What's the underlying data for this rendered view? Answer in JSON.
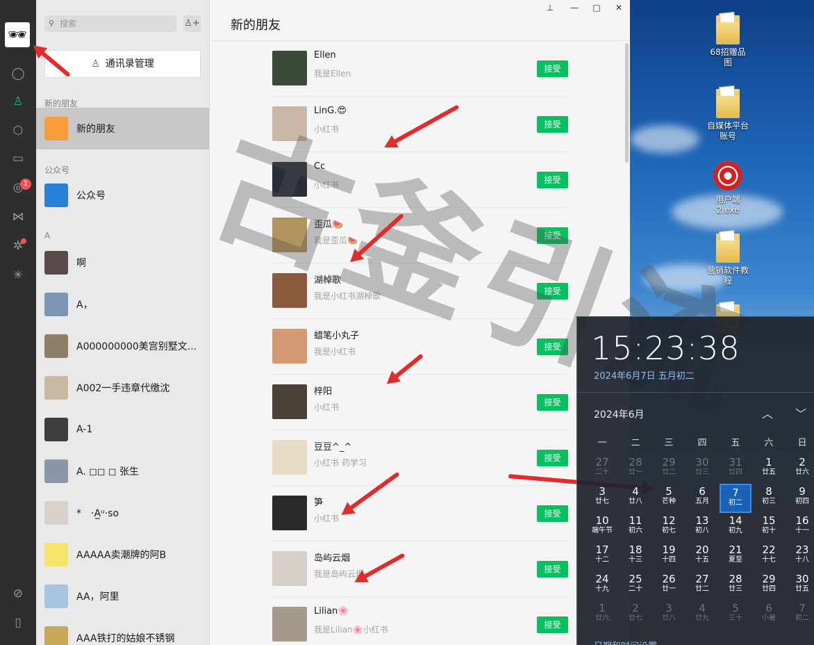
{
  "sidebar": {
    "avatar_glyph": "🕶",
    "badge_count": "1"
  },
  "list": {
    "search_placeholder": "搜索",
    "manage_label": "通讯录管理",
    "sections": {
      "new_friends": "新的朋友",
      "official": "公众号",
      "letter_a": "A"
    },
    "rows": [
      {
        "name": "新的朋友",
        "color": "#fa9d3b"
      },
      {
        "name": "公众号",
        "color": "#2782d7"
      },
      {
        "name": "啊",
        "color": "#5a4a4a"
      },
      {
        "name": "A，",
        "color": "#7e94b4"
      },
      {
        "name": "A000000000美宫别墅文...",
        "color": "#8f7f66"
      },
      {
        "name": "A002一手违章代缴沈",
        "color": "#c9b9a0"
      },
      {
        "name": "A-1",
        "color": "#3d3d3d"
      },
      {
        "name": "A. ◻◻ ◻ 张生",
        "color": "#8a95a5"
      },
      {
        "name": "*　·A̲ᵘ·so",
        "color": "#d9d2cc"
      },
      {
        "name": "AAAAA卖潮牌的阿B",
        "color": "#f5e36a"
      },
      {
        "name": "AA，阿里",
        "color": "#a6c4e0"
      },
      {
        "name": "AAA铁打的姑娘不锈钢",
        "color": "#c8a75a"
      }
    ]
  },
  "main": {
    "title": "新的朋友",
    "accept_label": "接受",
    "friends": [
      {
        "name": "Ellen",
        "msg": "我是Ellen",
        "color": "#3c4a3a"
      },
      {
        "name": "LinG.😍",
        "msg": "小红书",
        "color": "#c9b8a6"
      },
      {
        "name": "Cc",
        "msg": "小红书",
        "color": "#2a2e3a"
      },
      {
        "name": "歪瓜🍉",
        "msg": "我是歪瓜🍉",
        "color": "#b2935e"
      },
      {
        "name": "湖棹歌",
        "msg": "我是小红书湖棹歌",
        "color": "#8c5a3c"
      },
      {
        "name": "蜡笔小丸子",
        "msg": "我是小红书",
        "color": "#d49a73"
      },
      {
        "name": "梓阳",
        "msg": "小红书",
        "color": "#4a4238"
      },
      {
        "name": "豆豆^_^",
        "msg": "小红书 药学习",
        "color": "#e8dcc6"
      },
      {
        "name": "笋",
        "msg": "小红书",
        "color": "#2a2a2a"
      },
      {
        "name": "岛屿云烟",
        "msg": "我是岛屿云烟",
        "color": "#d7d0c8"
      },
      {
        "name": "Lilian🌸",
        "msg": "我是Lilian🌸小红书",
        "color": "#a69a8c"
      }
    ]
  },
  "watermark": "古釜引流",
  "desktop": {
    "icons": [
      {
        "label": "68招赠品图"
      },
      {
        "label": "自媒体平台账号"
      },
      {
        "label": "用户端2.exe"
      },
      {
        "label": "营销软件教程"
      }
    ]
  },
  "clock": {
    "time": "15:23:38",
    "date": "2024年6月7日 五月初二",
    "month": "2024年6月",
    "weekdays": [
      "一",
      "二",
      "三",
      "四",
      "五",
      "六",
      "日"
    ],
    "days": [
      {
        "d": "27",
        "l": "二十",
        "o": true
      },
      {
        "d": "28",
        "l": "廿一",
        "o": true
      },
      {
        "d": "29",
        "l": "廿二",
        "o": true
      },
      {
        "d": "30",
        "l": "廿三",
        "o": true
      },
      {
        "d": "31",
        "l": "廿四",
        "o": true
      },
      {
        "d": "1",
        "l": "廿五"
      },
      {
        "d": "2",
        "l": "廿六"
      },
      {
        "d": "3",
        "l": "廿七"
      },
      {
        "d": "4",
        "l": "廿八"
      },
      {
        "d": "5",
        "l": "芒种"
      },
      {
        "d": "6",
        "l": "五月"
      },
      {
        "d": "7",
        "l": "初二",
        "t": true
      },
      {
        "d": "8",
        "l": "初三"
      },
      {
        "d": "9",
        "l": "初四"
      },
      {
        "d": "10",
        "l": "端午节"
      },
      {
        "d": "11",
        "l": "初六"
      },
      {
        "d": "12",
        "l": "初七"
      },
      {
        "d": "13",
        "l": "初八"
      },
      {
        "d": "14",
        "l": "初九"
      },
      {
        "d": "15",
        "l": "初十"
      },
      {
        "d": "16",
        "l": "十一"
      },
      {
        "d": "17",
        "l": "十二"
      },
      {
        "d": "18",
        "l": "十三"
      },
      {
        "d": "19",
        "l": "十四"
      },
      {
        "d": "20",
        "l": "十五"
      },
      {
        "d": "21",
        "l": "夏至"
      },
      {
        "d": "22",
        "l": "十七"
      },
      {
        "d": "23",
        "l": "十八"
      },
      {
        "d": "24",
        "l": "十九"
      },
      {
        "d": "25",
        "l": "二十"
      },
      {
        "d": "26",
        "l": "廿一"
      },
      {
        "d": "27",
        "l": "廿二"
      },
      {
        "d": "28",
        "l": "廿三"
      },
      {
        "d": "29",
        "l": "廿四"
      },
      {
        "d": "30",
        "l": "廿五"
      },
      {
        "d": "1",
        "l": "廿六",
        "o": true
      },
      {
        "d": "2",
        "l": "廿七",
        "o": true
      },
      {
        "d": "3",
        "l": "廿八",
        "o": true
      },
      {
        "d": "4",
        "l": "廿九",
        "o": true
      },
      {
        "d": "5",
        "l": "三十",
        "o": true
      },
      {
        "d": "6",
        "l": "小暑",
        "o": true
      },
      {
        "d": "7",
        "l": "初二",
        "o": true
      }
    ],
    "settings_link": "日期和时间设置"
  }
}
